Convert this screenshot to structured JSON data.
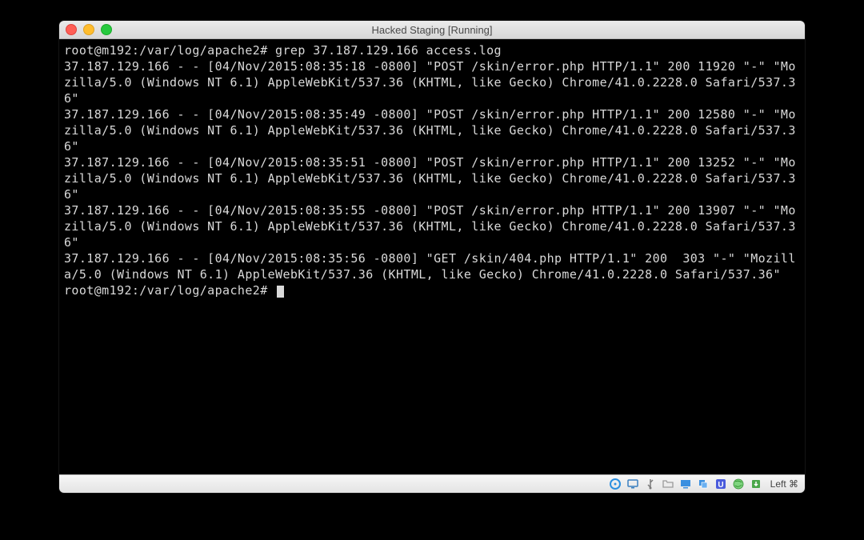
{
  "window": {
    "title": "Hacked Staging [Running]"
  },
  "terminal": {
    "prompt1": "root@m192:/var/log/apache2# grep 37.187.129.166 access.log",
    "log1": "37.187.129.166 - - [04/Nov/2015:08:35:18 -0800] \"POST /skin/error.php HTTP/1.1\" 200 11920 \"-\" \"Mozilla/5.0 (Windows NT 6.1) AppleWebKit/537.36 (KHTML, like Gecko) Chrome/41.0.2228.0 Safari/537.36\"",
    "log2": "37.187.129.166 - - [04/Nov/2015:08:35:49 -0800] \"POST /skin/error.php HTTP/1.1\" 200 12580 \"-\" \"Mozilla/5.0 (Windows NT 6.1) AppleWebKit/537.36 (KHTML, like Gecko) Chrome/41.0.2228.0 Safari/537.36\"",
    "log3": "37.187.129.166 - - [04/Nov/2015:08:35:51 -0800] \"POST /skin/error.php HTTP/1.1\" 200 13252 \"-\" \"Mozilla/5.0 (Windows NT 6.1) AppleWebKit/537.36 (KHTML, like Gecko) Chrome/41.0.2228.0 Safari/537.36\"",
    "log4": "37.187.129.166 - - [04/Nov/2015:08:35:55 -0800] \"POST /skin/error.php HTTP/1.1\" 200 13907 \"-\" \"Mozilla/5.0 (Windows NT 6.1) AppleWebKit/537.36 (KHTML, like Gecko) Chrome/41.0.2228.0 Safari/537.36\"",
    "log5": "37.187.129.166 - - [04/Nov/2015:08:35:56 -0800] \"GET /skin/404.php HTTP/1.1\" 200  303 \"-\" \"Mozilla/5.0 (Windows NT 6.1) AppleWebKit/537.36 (KHTML, like Gecko) Chrome/41.0.2228.0 Safari/537.36\"",
    "prompt2": "root@m192:/var/log/apache2# "
  },
  "statusbar": {
    "left_label": "Left ⌘"
  }
}
